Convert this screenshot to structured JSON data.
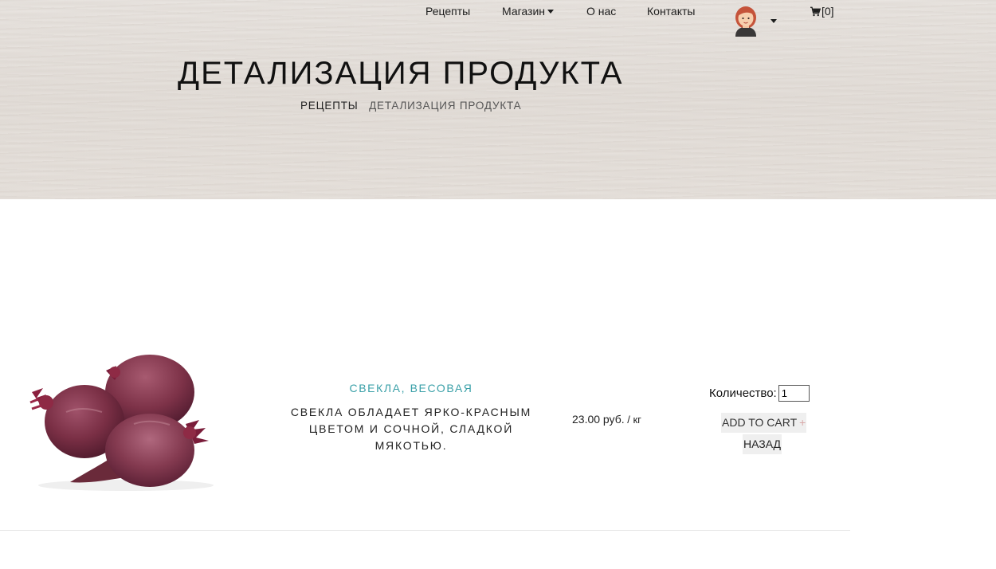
{
  "nav": {
    "recipes": "Рецепты",
    "shop": "Магазин",
    "about": "О нас",
    "contacts": "Контакты",
    "cart_label": "[0]"
  },
  "header": {
    "title": "ДЕТАЛИЗАЦИЯ ПРОДУКТА",
    "breadcrumb": {
      "link": "РЕЦЕПТЫ",
      "current": "ДЕТАЛИЗАЦИЯ ПРОДУКТА"
    }
  },
  "product": {
    "name": "СВЕКЛА, ВЕСОВАЯ",
    "description": "СВЕКЛА ОБЛАДАЕТ ЯРКО-КРАСНЫМ ЦВЕТОМ И СОЧНОЙ, СЛАДКОЙ МЯКОТЬЮ.",
    "price": "23.00 руб.",
    "price_unit": " / кг",
    "quantity_label": "Количество:",
    "quantity_value": "1",
    "add_to_cart": "ADD TO CART",
    "add_icon": "+",
    "back": "НАЗАД"
  },
  "icons": {
    "cart": "shopping-cart-icon",
    "avatar": "user-avatar",
    "dropdown": "caret-down-icon"
  },
  "colors": {
    "accent": "#3aa0a8",
    "hero_bg": "#e6e1dc",
    "button_bg": "#efefef"
  }
}
